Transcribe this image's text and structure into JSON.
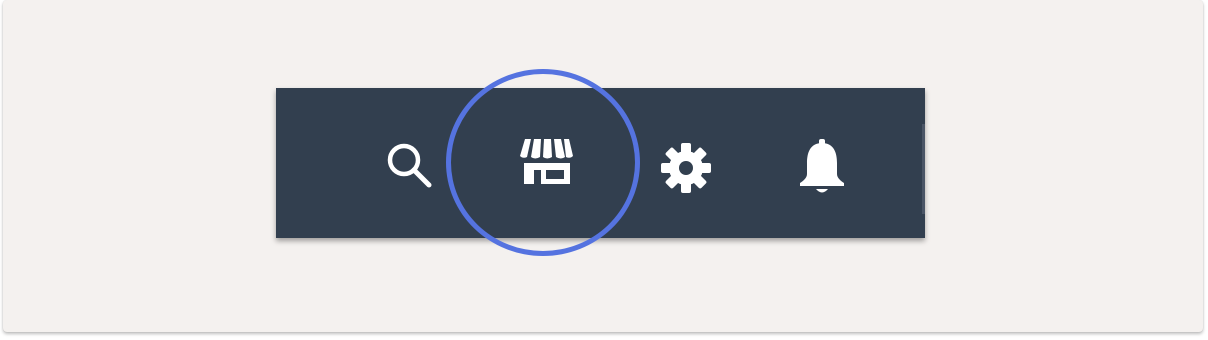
{
  "toolbar": {
    "background_color": "#323f4f",
    "icon_color": "#ffffff",
    "items": [
      {
        "id": "search",
        "icon": "search-icon"
      },
      {
        "id": "store",
        "icon": "store-icon"
      },
      {
        "id": "settings",
        "icon": "gear-icon"
      },
      {
        "id": "notifications",
        "icon": "bell-icon"
      }
    ]
  },
  "highlight": {
    "target": "store",
    "color": "#5573e0"
  },
  "page": {
    "background_color": "#f4f1ef"
  }
}
